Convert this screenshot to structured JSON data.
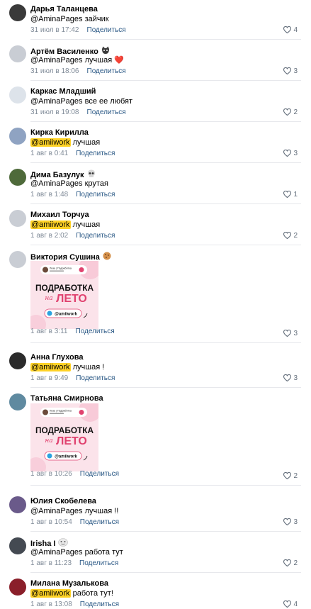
{
  "share_label": "Поделиться",
  "colors": {
    "mention_highlight": "#ffd226",
    "link": "#2a5885",
    "meta": "#818c99",
    "promo_bg": "#fbe3ea",
    "promo_accent": "#e0426f"
  },
  "promo": {
    "header_name": "Лиза | Подработка",
    "title_line1": "ПОДРАБОТКА",
    "title_on": "на",
    "title_line2": "ЛЕТО",
    "handle": "@amiiwork"
  },
  "comments": [
    {
      "author": "Дарья Таланцева",
      "emoji": "",
      "mention": "@AminaPages",
      "highlight": false,
      "text": " зайчик",
      "date": "31 июл в 17:42",
      "likes": "4",
      "has_image": false,
      "avatar_color": "#3a3a3a"
    },
    {
      "author": "Артём Василенко",
      "emoji": "cat-emoji",
      "mention": "@AminaPages",
      "highlight": false,
      "text": " лучшая ❤️",
      "date": "31 июл в 18:06",
      "likes": "3",
      "has_image": false,
      "avatar_color": "#c9cdd4"
    },
    {
      "author": "Каркас Младший",
      "emoji": "",
      "mention": "@AminaPages",
      "highlight": false,
      "text": " все ее любят",
      "date": "31 июл в 19:08",
      "likes": "2",
      "has_image": false,
      "avatar_color": "#dde3ea"
    },
    {
      "author": "Кирка Кирилла",
      "emoji": "",
      "mention": "@amiiwork",
      "highlight": true,
      "text": " лучшая",
      "date": "1 авг в 0:41",
      "likes": "3",
      "has_image": false,
      "avatar_color": "#8fa3c2"
    },
    {
      "author": "Дима Базулук",
      "emoji": "skull-emoji",
      "mention": "@AminaPages",
      "highlight": false,
      "text": " крутая",
      "date": "1 авг в 1:48",
      "likes": "1",
      "has_image": false,
      "avatar_color": "#4e6a3a"
    },
    {
      "author": "Михаил Торчуа",
      "emoji": "",
      "mention": "@amiiwork",
      "highlight": true,
      "text": " лучшая",
      "date": "1 авг в 2:02",
      "likes": "2",
      "has_image": false,
      "avatar_color": "#c9cdd4"
    },
    {
      "author": "Виктория Сушина",
      "emoji": "cookie-emoji",
      "mention": "",
      "highlight": false,
      "text": "",
      "date": "1 авг в 3:11",
      "likes": "3",
      "has_image": true,
      "avatar_color": "#c9cdd4"
    },
    {
      "author": "Анна Глухова",
      "emoji": "",
      "mention": "@amiiwork",
      "highlight": true,
      "text": " лучшая !",
      "date": "1 авг в 9:49",
      "likes": "3",
      "has_image": false,
      "avatar_color": "#2b2b2b"
    },
    {
      "author": "Татьяна Смирнова",
      "emoji": "",
      "mention": "",
      "highlight": false,
      "text": "",
      "date": "1 авг в 10:26",
      "likes": "2",
      "has_image": true,
      "avatar_color": "#5f8aa0"
    },
    {
      "author": "Юлия Скобелева",
      "emoji": "",
      "mention": "@AminaPages",
      "highlight": false,
      "text": " лучшая !!",
      "date": "1 авг в 10:54",
      "likes": "3",
      "has_image": false,
      "avatar_color": "#6a5a8a"
    },
    {
      "author": "Irisha I",
      "emoji": "face-emoji",
      "mention": "@AminaPages",
      "highlight": false,
      "text": " работа тут",
      "date": "1 авг в 11:23",
      "likes": "2",
      "has_image": false,
      "avatar_color": "#444a52"
    },
    {
      "author": "Милана Музалькова",
      "emoji": "",
      "mention": "@amiiwork",
      "highlight": true,
      "text": " работа тут!",
      "date": "1 авг в 13:08",
      "likes": "4",
      "has_image": false,
      "avatar_color": "#8a1f2a"
    }
  ]
}
